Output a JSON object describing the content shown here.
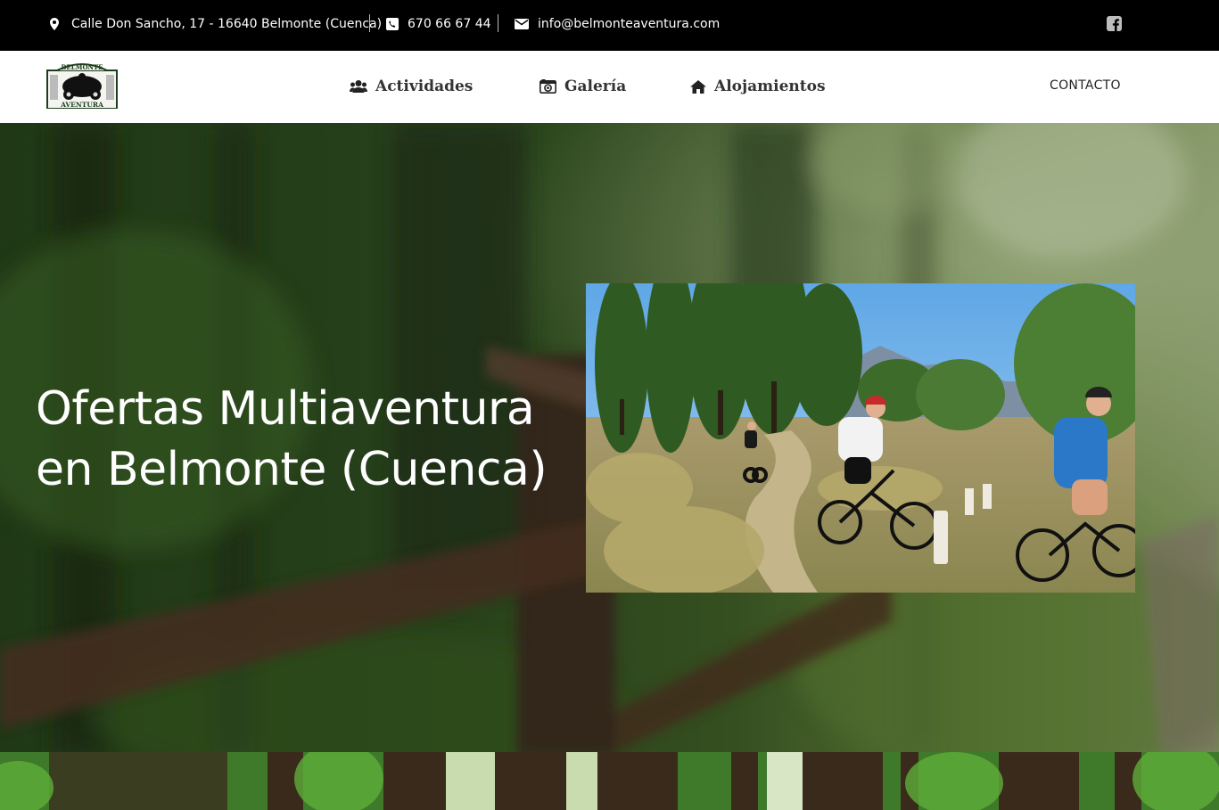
{
  "topbar": {
    "address": "Calle Don Sancho, 17 - 16640 Belmonte (Cuenca)",
    "phone": "670 66 67 44",
    "email": "info@belmonteaventura.com",
    "icons": [
      "map-marker-icon",
      "phone-icon",
      "envelope-icon",
      "facebook-icon"
    ]
  },
  "logo": {
    "top_text": "BELMONTE",
    "bottom_text": "AVENTURA"
  },
  "nav": {
    "items": [
      {
        "label": "Actividades",
        "icon": "users-icon"
      },
      {
        "label": "Galería",
        "icon": "camera-icon"
      },
      {
        "label": "Alojamientos",
        "icon": "home-icon"
      }
    ],
    "contact_label": "CONTACTO"
  },
  "hero": {
    "title_line1": "Ofertas Multiaventura",
    "title_line2": "en Belmonte (Cuenca)"
  },
  "colors": {
    "topbar_bg": "#000000",
    "nav_text": "#333333",
    "hero_green": "#2f4a1c"
  }
}
